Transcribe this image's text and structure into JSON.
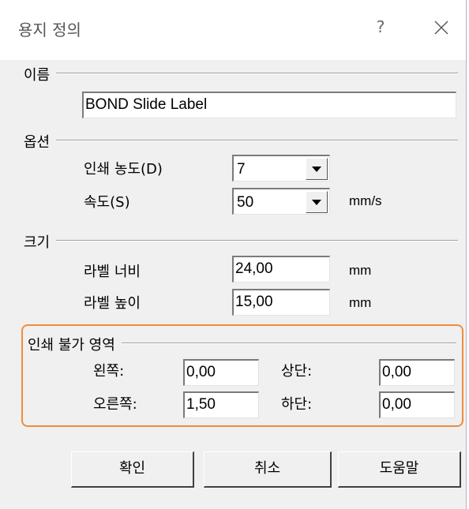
{
  "dialog": {
    "title": "용지 정의",
    "help_label": "?"
  },
  "name_group": {
    "label": "이름",
    "value": "BOND Slide Label"
  },
  "options_group": {
    "label": "옵션",
    "print_density_label": "인쇄 농도(D)",
    "print_density_value": "7",
    "speed_label": "속도(S)",
    "speed_value": "50",
    "speed_unit": "mm/s"
  },
  "size_group": {
    "label": "크기",
    "width_label": "라벨 너비",
    "width_value": "24,00",
    "width_unit": "mm",
    "height_label": "라벨 높이",
    "height_value": "15,00",
    "height_unit": "mm"
  },
  "nonprint_group": {
    "label": "인쇄 불가 영역",
    "left_label": "왼쪽:",
    "left_value": "0,00",
    "top_label": "상단:",
    "top_value": "0,00",
    "right_label": "오른쪽:",
    "right_value": "1,50",
    "bottom_label": "하단:",
    "bottom_value": "0,00"
  },
  "buttons": {
    "ok": "확인",
    "cancel": "취소",
    "help": "도움말"
  },
  "colors": {
    "highlight": "#f08c3c",
    "dialog_bg": "#f0f0f0"
  }
}
